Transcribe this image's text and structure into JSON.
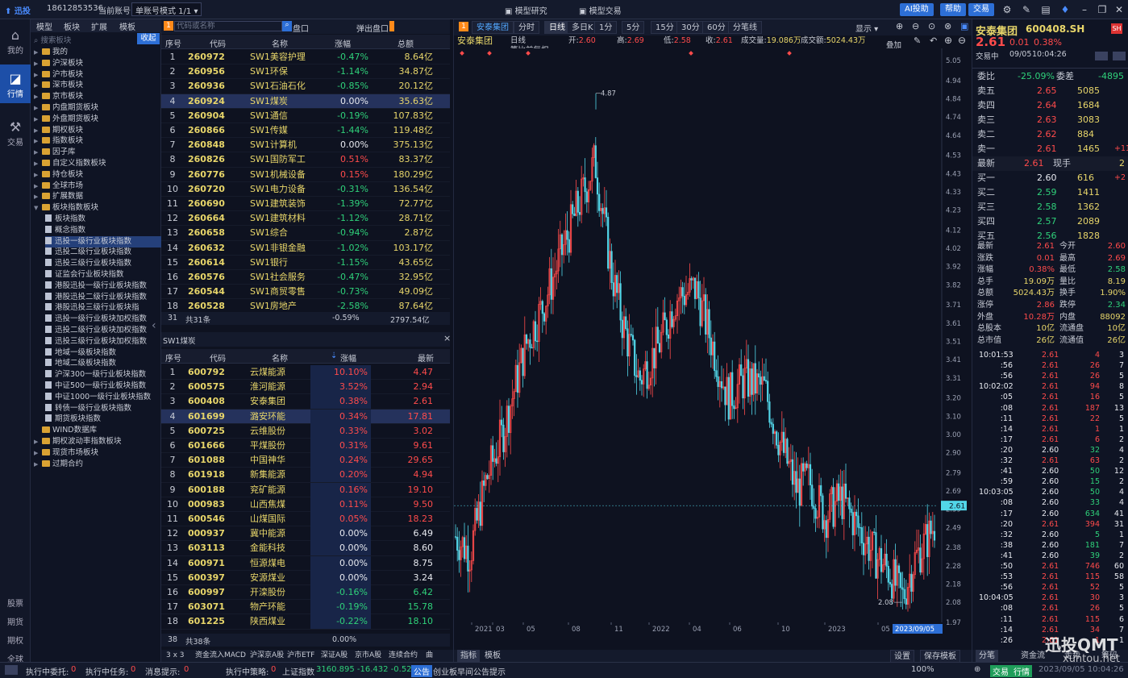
{
  "app": {
    "logo": "迅投",
    "phone": "18612853536",
    "account_label": "当前账号",
    "mode": "单账号模式 1/1",
    "menu_research": "模型研究",
    "menu_trade": "模型交易",
    "ai_btn": "AI投助",
    "help_btn": "帮助",
    "trade_btn": "交易"
  },
  "nav": [
    {
      "label": "我的",
      "icon": "home"
    },
    {
      "label": "行情",
      "icon": "chart"
    },
    {
      "label": "交易",
      "icon": "tools"
    }
  ],
  "nav_bottom": [
    "股票",
    "期货",
    "期权",
    "全球"
  ],
  "tree": {
    "tabs": [
      "模型",
      "板块",
      "扩展",
      "模板"
    ],
    "search_placeholder": "搜索板块",
    "collapse": "收起",
    "items": [
      {
        "label": "我的",
        "lvl": 0,
        "folder": true
      },
      {
        "label": "沪深板块",
        "lvl": 0,
        "folder": true
      },
      {
        "label": "沪市板块",
        "lvl": 0,
        "folder": true
      },
      {
        "label": "深市板块",
        "lvl": 0,
        "folder": true
      },
      {
        "label": "京市板块",
        "lvl": 0,
        "folder": true
      },
      {
        "label": "内盘期货板块",
        "lvl": 0,
        "folder": true
      },
      {
        "label": "外盘期货板块",
        "lvl": 0,
        "folder": true
      },
      {
        "label": "期权板块",
        "lvl": 0,
        "folder": true
      },
      {
        "label": "指数板块",
        "lvl": 0,
        "folder": true
      },
      {
        "label": "因子库",
        "lvl": 0,
        "folder": true
      },
      {
        "label": "自定义指数板块",
        "lvl": 0,
        "folder": true
      },
      {
        "label": "持仓板块",
        "lvl": 0,
        "folder": true
      },
      {
        "label": "全球市场",
        "lvl": 0,
        "folder": true
      },
      {
        "label": "扩展数据",
        "lvl": 0,
        "folder": true
      },
      {
        "label": "板块指数板块",
        "lvl": 0,
        "folder": true,
        "open": true
      },
      {
        "label": "板块指数",
        "lvl": 1
      },
      {
        "label": "概念指数",
        "lvl": 1
      },
      {
        "label": "迅投一级行业板块指数",
        "lvl": 1,
        "sel": true
      },
      {
        "label": "迅投二级行业板块指数",
        "lvl": 1
      },
      {
        "label": "迅投三级行业板块指数",
        "lvl": 1
      },
      {
        "label": "证监会行业板块指数",
        "lvl": 1
      },
      {
        "label": "港股迅投一级行业板块指数",
        "lvl": 1
      },
      {
        "label": "港股迅投二级行业板块指数",
        "lvl": 1
      },
      {
        "label": "港股迅投三级行业板块指",
        "lvl": 1
      },
      {
        "label": "迅投一级行业板块加权指数",
        "lvl": 1
      },
      {
        "label": "迅投二级行业板块加权指数",
        "lvl": 1
      },
      {
        "label": "迅投三级行业板块加权指数",
        "lvl": 1
      },
      {
        "label": "地域一级板块指数",
        "lvl": 1
      },
      {
        "label": "地域二级板块指数",
        "lvl": 1
      },
      {
        "label": "沪深300一级行业板块指数",
        "lvl": 1
      },
      {
        "label": "中证500一级行业板块指数",
        "lvl": 1
      },
      {
        "label": "中证1000一级行业板块指数",
        "lvl": 1
      },
      {
        "label": "转债一级行业板块指数",
        "lvl": 1
      },
      {
        "label": "期货板块指数",
        "lvl": 1
      },
      {
        "label": "WIND数据库",
        "lvl": 0,
        "folder": true,
        "noarrow": true
      },
      {
        "label": "期权波动率指数板块",
        "lvl": 0,
        "folder": true
      },
      {
        "label": "现货市场板块",
        "lvl": 0,
        "folder": true
      },
      {
        "label": "过期合约",
        "lvl": 0,
        "folder": true
      }
    ]
  },
  "table1": {
    "search_placeholder": "代码或名称",
    "pan": "盘口",
    "popout": "弹出盘口",
    "headers": [
      "序号",
      "代码",
      "名称",
      "涨幅",
      "总额"
    ],
    "rows": [
      [
        "1",
        "260972",
        "SW1美容护理",
        "-0.47%",
        "8.64亿"
      ],
      [
        "2",
        "260956",
        "SW1环保",
        "-1.14%",
        "34.87亿"
      ],
      [
        "3",
        "260936",
        "SW1石油石化",
        "-0.85%",
        "20.12亿"
      ],
      [
        "4",
        "260924",
        "SW1煤炭",
        "0.00%",
        "35.63亿"
      ],
      [
        "5",
        "260904",
        "SW1通信",
        "-0.19%",
        "107.83亿"
      ],
      [
        "6",
        "260866",
        "SW1传媒",
        "-1.44%",
        "119.48亿"
      ],
      [
        "7",
        "260848",
        "SW1计算机",
        "0.00%",
        "375.13亿"
      ],
      [
        "8",
        "260826",
        "SW1国防军工",
        "0.51%",
        "83.37亿"
      ],
      [
        "9",
        "260776",
        "SW1机械设备",
        "0.15%",
        "180.29亿"
      ],
      [
        "10",
        "260720",
        "SW1电力设备",
        "-0.31%",
        "136.54亿"
      ],
      [
        "11",
        "260690",
        "SW1建筑装饰",
        "-1.39%",
        "72.77亿"
      ],
      [
        "12",
        "260664",
        "SW1建筑材料",
        "-1.12%",
        "28.71亿"
      ],
      [
        "13",
        "260658",
        "SW1综合",
        "-0.94%",
        "2.87亿"
      ],
      [
        "14",
        "260632",
        "SW1非银金融",
        "-1.02%",
        "103.17亿"
      ],
      [
        "15",
        "260614",
        "SW1银行",
        "-1.15%",
        "43.65亿"
      ],
      [
        "16",
        "260576",
        "SW1社会服务",
        "-0.47%",
        "32.95亿"
      ],
      [
        "17",
        "260544",
        "SW1商贸零售",
        "-0.73%",
        "49.09亿"
      ],
      [
        "18",
        "260528",
        "SW1房地产",
        "-2.58%",
        "87.64亿"
      ]
    ],
    "footer": [
      "31",
      "共31条",
      "-0.59%",
      "2797.54亿"
    ]
  },
  "table2": {
    "title": "SW1煤炭",
    "headers": [
      "序号",
      "代码",
      "名称",
      "涨幅",
      "最新"
    ],
    "rows": [
      [
        "1",
        "600792",
        "云煤能源",
        "10.10%",
        "4.47"
      ],
      [
        "2",
        "600575",
        "淮河能源",
        "3.52%",
        "2.94"
      ],
      [
        "3",
        "600408",
        "安泰集团",
        "0.38%",
        "2.61"
      ],
      [
        "4",
        "601699",
        "潞安环能",
        "0.34%",
        "17.81"
      ],
      [
        "5",
        "600725",
        "云维股份",
        "0.33%",
        "3.02"
      ],
      [
        "6",
        "601666",
        "平煤股份",
        "0.31%",
        "9.61"
      ],
      [
        "7",
        "601088",
        "中国神华",
        "0.24%",
        "29.65"
      ],
      [
        "8",
        "601918",
        "新集能源",
        "0.20%",
        "4.94"
      ],
      [
        "9",
        "600188",
        "兖矿能源",
        "0.16%",
        "19.10"
      ],
      [
        "10",
        "000983",
        "山西焦煤",
        "0.11%",
        "9.50"
      ],
      [
        "11",
        "600546",
        "山煤国际",
        "0.05%",
        "18.23"
      ],
      [
        "12",
        "000937",
        "冀中能源",
        "0.00%",
        "6.49"
      ],
      [
        "13",
        "603113",
        "金能科技",
        "0.00%",
        "8.60"
      ],
      [
        "14",
        "600971",
        "恒源煤电",
        "0.00%",
        "8.75"
      ],
      [
        "15",
        "600397",
        "安源煤业",
        "0.00%",
        "3.24"
      ],
      [
        "16",
        "600997",
        "开滦股份",
        "-0.16%",
        "6.42"
      ],
      [
        "17",
        "603071",
        "物产环能",
        "-0.19%",
        "15.78"
      ],
      [
        "18",
        "601225",
        "陕西煤业",
        "-0.22%",
        "18.10"
      ]
    ],
    "footer": [
      "38",
      "共38条",
      "0.00%"
    ]
  },
  "bottom_tabs": [
    "3 x 3",
    "资金流入MACD",
    "沪深京A股",
    "沪市ETF",
    "深证A股",
    "京市A股",
    "连续合约",
    "曲"
  ],
  "chart": {
    "tabs": [
      "安泰集团",
      "分时",
      "日线",
      "多日K",
      "1分",
      "5分",
      "15分",
      "30分",
      "60分",
      "分笔线"
    ],
    "show": "显示",
    "stock": "安泰集团",
    "period": "日线",
    "adjust": "等比前复权",
    "overlay": "叠加",
    "ohlc": [
      {
        "k": "开:",
        "v": "2.60"
      },
      {
        "k": "高:",
        "v": "2.69"
      },
      {
        "k": "低:",
        "v": "2.58"
      },
      {
        "k": "收:",
        "v": "2.61"
      },
      {
        "k": "成交量:",
        "v": "19.086万"
      },
      {
        "k": "成交额:",
        "v": "5024.43万"
      }
    ],
    "y_ticks": [
      "5.05",
      "4.94",
      "4.84",
      "4.74",
      "4.64",
      "4.53",
      "4.43",
      "4.33",
      "4.23",
      "4.12",
      "4.02",
      "3.92",
      "3.82",
      "3.71",
      "3.61",
      "3.51",
      "3.41",
      "3.31",
      "3.20",
      "3.10",
      "3.00",
      "2.90",
      "2.79",
      "2.69",
      "2.59",
      "2.49",
      "2.38",
      "2.28",
      "2.18",
      "2.08",
      "1.97"
    ],
    "x_ticks": [
      "2021",
      "03",
      "05",
      "08",
      "11",
      "2022",
      "04",
      "06",
      "10",
      "2023",
      "05"
    ],
    "x_cursor": "2023/09/05",
    "last_price": "2.61",
    "high_label": "4.87",
    "low_label": "2.08",
    "bottom_btns": [
      "指标",
      "模板"
    ],
    "settings": "设置",
    "save_template": "保存模板"
  },
  "quote": {
    "name": "安泰集团",
    "code": "600408.SH",
    "badge": "SH",
    "price": "2.61",
    "chg": "0.01",
    "pct": "0.38%",
    "status": "交易中",
    "date": "09/05",
    "time": "10:04:26",
    "weibi_label": "委比",
    "weibi": "-25.09%",
    "weicha_label": "委差",
    "weicha": "-4895",
    "asks": [
      [
        "卖五",
        "2.65",
        "5085",
        ""
      ],
      [
        "卖四",
        "2.64",
        "1684",
        ""
      ],
      [
        "卖三",
        "2.63",
        "3083",
        ""
      ],
      [
        "卖二",
        "2.62",
        "884",
        ""
      ],
      [
        "卖一",
        "2.61",
        "1465",
        "+11"
      ]
    ],
    "last_label": "最新",
    "last": "2.61",
    "xianshou_label": "现手",
    "xianshou": "2",
    "bids": [
      [
        "买一",
        "2.60",
        "616",
        "+2"
      ],
      [
        "买二",
        "2.59",
        "1411",
        ""
      ],
      [
        "买三",
        "2.58",
        "1362",
        ""
      ],
      [
        "买四",
        "2.57",
        "2089",
        ""
      ],
      [
        "买五",
        "2.56",
        "1828",
        ""
      ]
    ],
    "stats": [
      [
        "最新",
        "2.61",
        "今开",
        "2.60"
      ],
      [
        "涨跌",
        "0.01",
        "最高",
        "2.69"
      ],
      [
        "涨幅",
        "0.38%",
        "最低",
        "2.58"
      ],
      [
        "总手",
        "19.09万",
        "量比",
        "8.19"
      ],
      [
        "总额",
        "5024.43万",
        "换手",
        "1.90%"
      ],
      [
        "涨停",
        "2.86",
        "跌停",
        "2.34"
      ],
      [
        "外盘",
        "10.28万",
        "内盘",
        "88092"
      ],
      [
        "总股本",
        "10亿",
        "流通盘",
        "10亿"
      ],
      [
        "总市值",
        "26亿",
        "流通值",
        "26亿"
      ]
    ],
    "ticks": [
      [
        "10:01:53",
        "2.61",
        "4",
        "3"
      ],
      [
        ":56",
        "2.61",
        "26",
        "7"
      ],
      [
        ":56",
        "2.61",
        "26",
        "5"
      ],
      [
        "10:02:02",
        "2.61",
        "94",
        "8"
      ],
      [
        ":05",
        "2.61",
        "16",
        "5"
      ],
      [
        ":08",
        "2.61",
        "187",
        "13"
      ],
      [
        ":11",
        "2.61",
        "22",
        "5"
      ],
      [
        ":14",
        "2.61",
        "1",
        "1"
      ],
      [
        ":17",
        "2.61",
        "6",
        "2"
      ],
      [
        ":20",
        "2.60",
        "32",
        "4"
      ],
      [
        ":32",
        "2.61",
        "63",
        "2"
      ],
      [
        ":41",
        "2.60",
        "50",
        "12"
      ],
      [
        ":59",
        "2.60",
        "15",
        "2"
      ],
      [
        "10:03:05",
        "2.60",
        "50",
        "4"
      ],
      [
        ":08",
        "2.60",
        "33",
        "4"
      ],
      [
        ":17",
        "2.60",
        "634",
        "41"
      ],
      [
        ":20",
        "2.61",
        "394",
        "31"
      ],
      [
        ":32",
        "2.60",
        "5",
        "1"
      ],
      [
        ":38",
        "2.60",
        "181",
        "7"
      ],
      [
        ":41",
        "2.60",
        "39",
        "2"
      ],
      [
        ":50",
        "2.61",
        "746",
        "60"
      ],
      [
        ":53",
        "2.61",
        "115",
        "58"
      ],
      [
        ":56",
        "2.61",
        "52",
        "5"
      ],
      [
        "10:04:05",
        "2.61",
        "30",
        "3"
      ],
      [
        ":08",
        "2.61",
        "26",
        "5"
      ],
      [
        ":11",
        "2.61",
        "115",
        "6"
      ],
      [
        ":14",
        "2.61",
        "34",
        "7"
      ],
      [
        ":26",
        "2.61",
        "1",
        "1"
      ]
    ],
    "tabs": [
      "分笔",
      "资金流",
      "走势",
      "筹码"
    ],
    "watermark": "迅投QMT",
    "watermark2": "xuntou.net"
  },
  "status": {
    "exec_orders": "执行中委托:",
    "exec_orders_v": "0",
    "exec_tasks": "执行中任务:",
    "exec_tasks_v": "0",
    "hint": "消息提示:",
    "hint_v": "0",
    "strategy": "执行中策略:",
    "strategy_v": "0",
    "index": "上证指数",
    "index_v": "3160.895 -16.432 -0.52%",
    "notice_tag": "公告",
    "notice": "创业板早间公告提示",
    "zoom": "100%",
    "trade": "交易",
    "quote": "行情",
    "datetime": "2023/09/05 10:04:26"
  },
  "colors": {
    "up": "#ff4b4b",
    "down": "#2fd17a",
    "accent": "#2d6fd6"
  }
}
